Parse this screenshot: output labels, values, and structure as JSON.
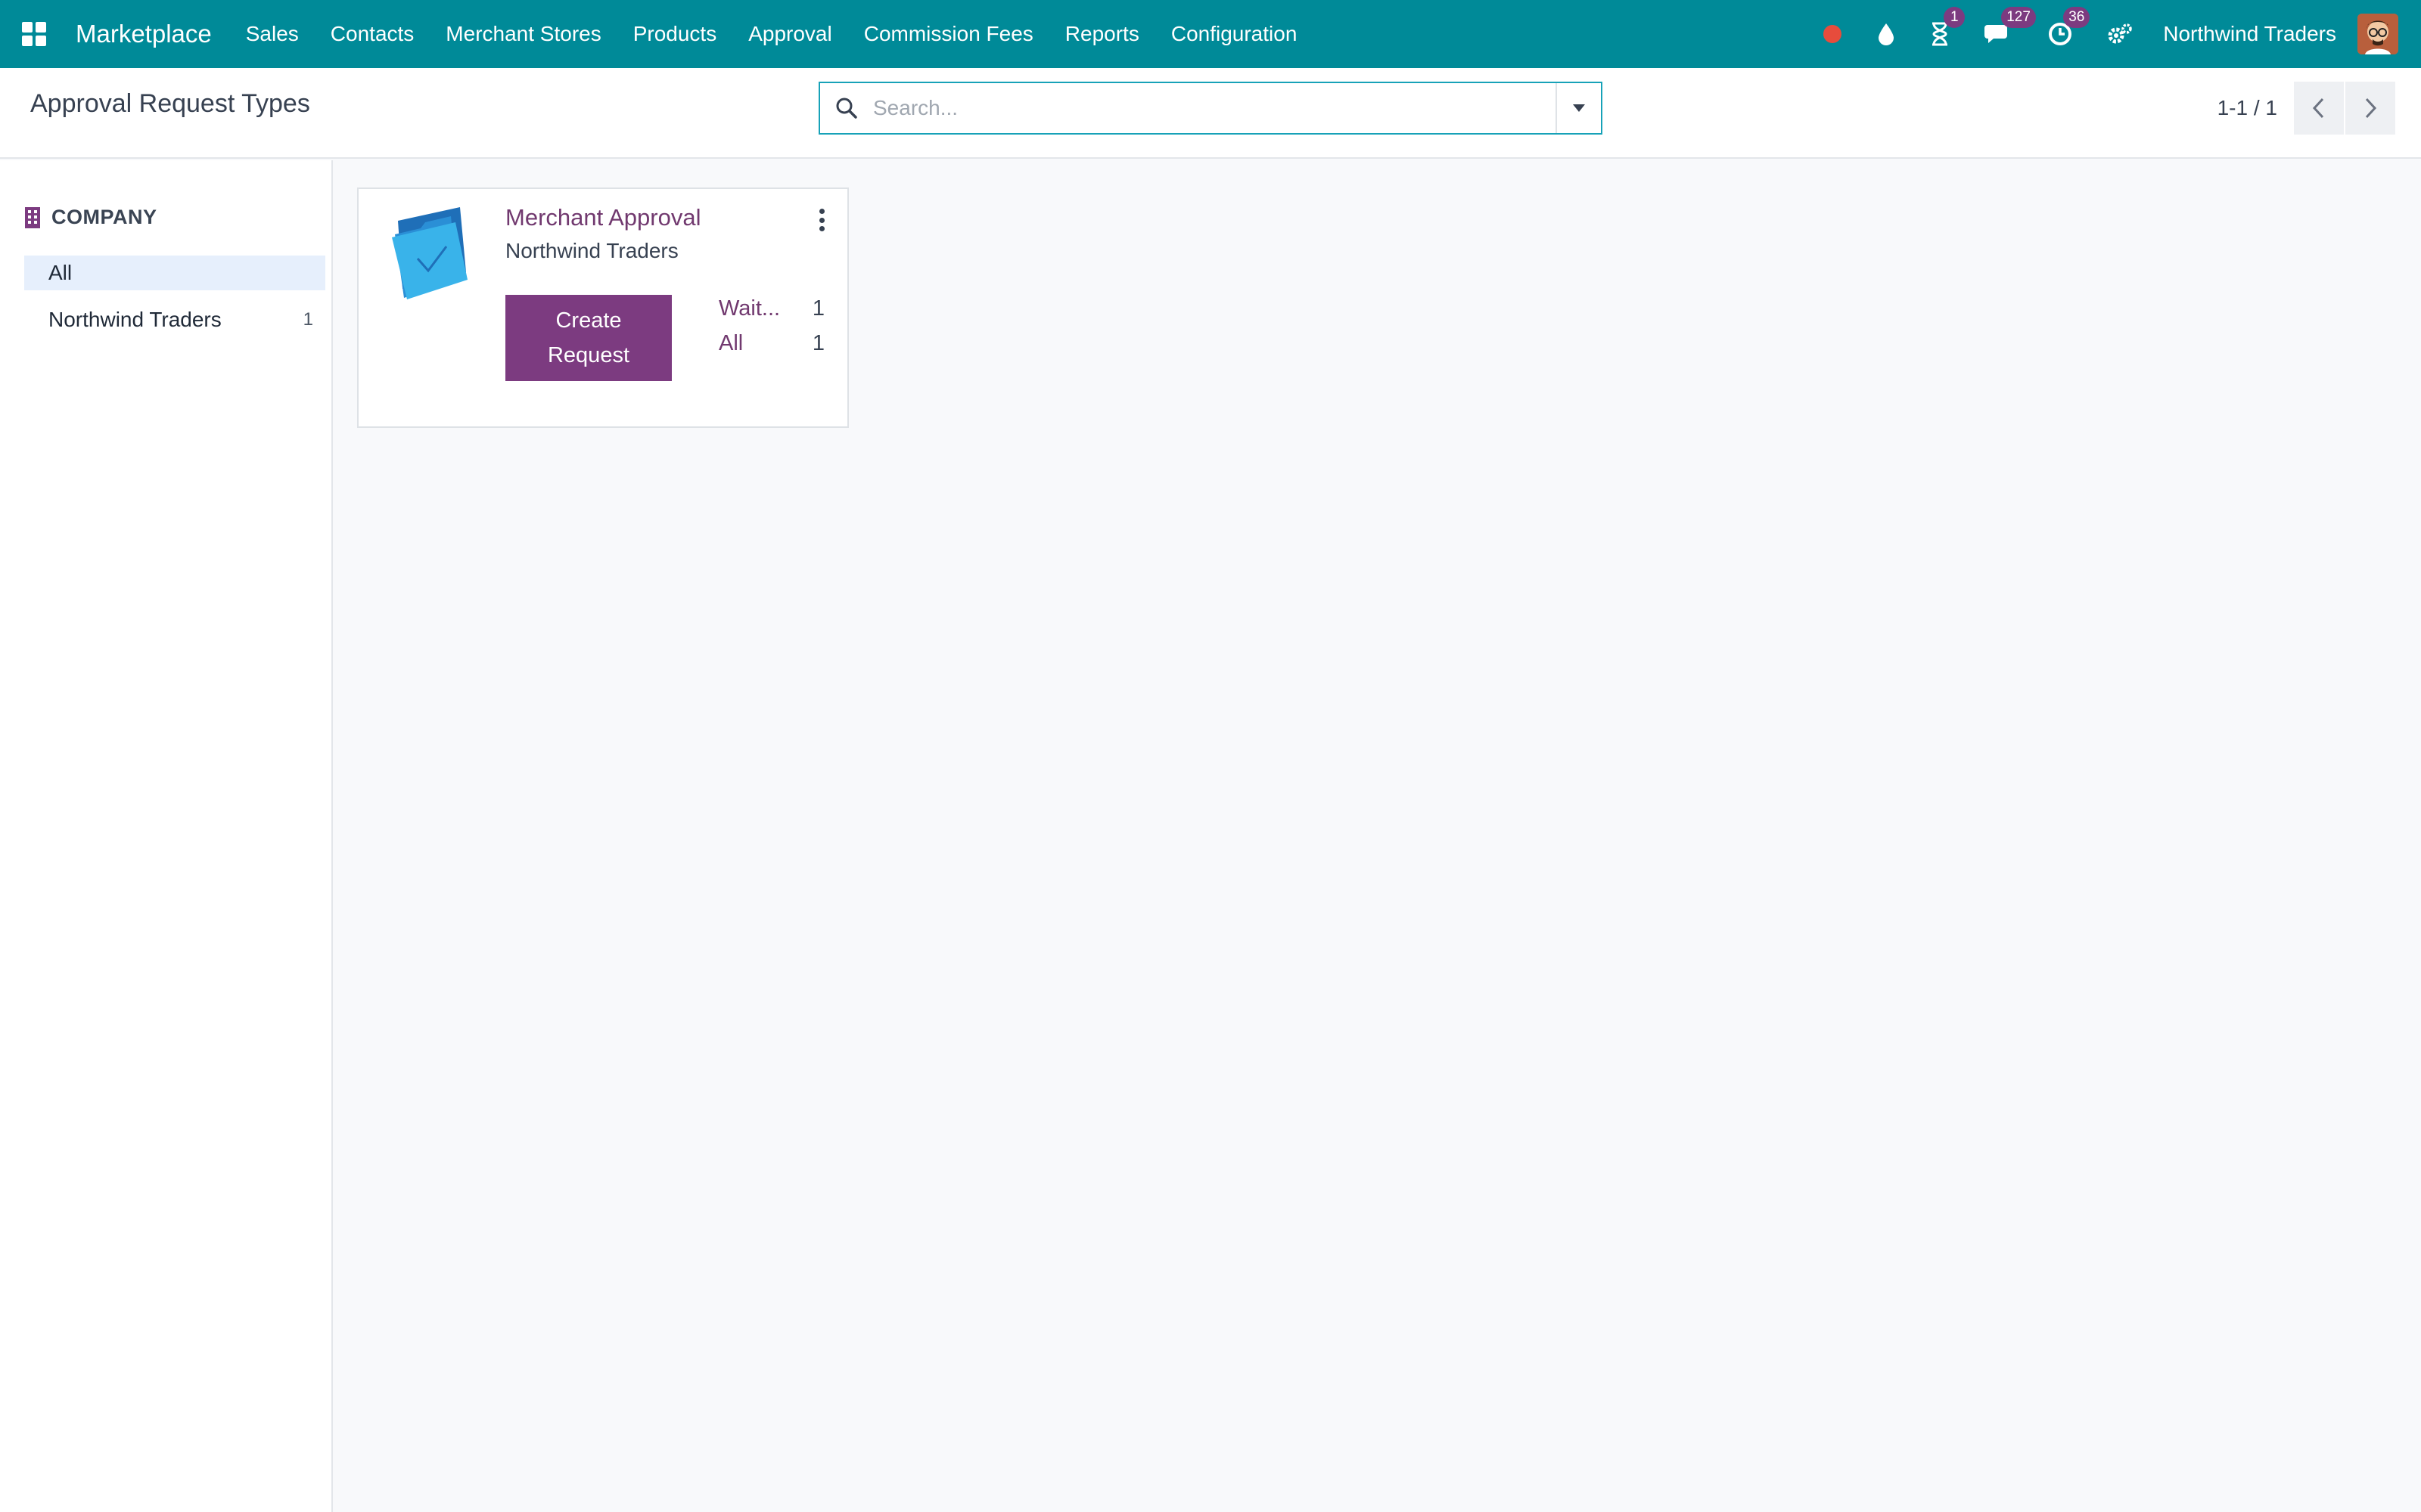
{
  "navbar": {
    "brand": "Marketplace",
    "menu": [
      "Sales",
      "Contacts",
      "Merchant Stores",
      "Products",
      "Approval",
      "Commission Fees",
      "Reports",
      "Configuration"
    ],
    "systray": {
      "activities_badge": "1",
      "messages_badge": "127",
      "clock_badge": "36",
      "record_color": "#e74c3c"
    },
    "company": "Northwind Traders"
  },
  "control_panel": {
    "title": "Approval Request Types",
    "search_placeholder": "Search...",
    "pager": "1-1 / 1"
  },
  "sidebar": {
    "heading": "COMPANY",
    "items": [
      {
        "label": "All",
        "count": ""
      },
      {
        "label": "Northwind Traders",
        "count": "1"
      }
    ]
  },
  "card": {
    "title": "Merchant Approval",
    "company": "Northwind Traders",
    "create_label": "Create Request",
    "stats": [
      {
        "label": "Wait...",
        "value": "1"
      },
      {
        "label": "All",
        "value": "1"
      }
    ]
  },
  "colors": {
    "navbar": "#008a98",
    "primary": "#7c3b80",
    "link": "#71396f",
    "search_focus": "#17a2b8"
  }
}
